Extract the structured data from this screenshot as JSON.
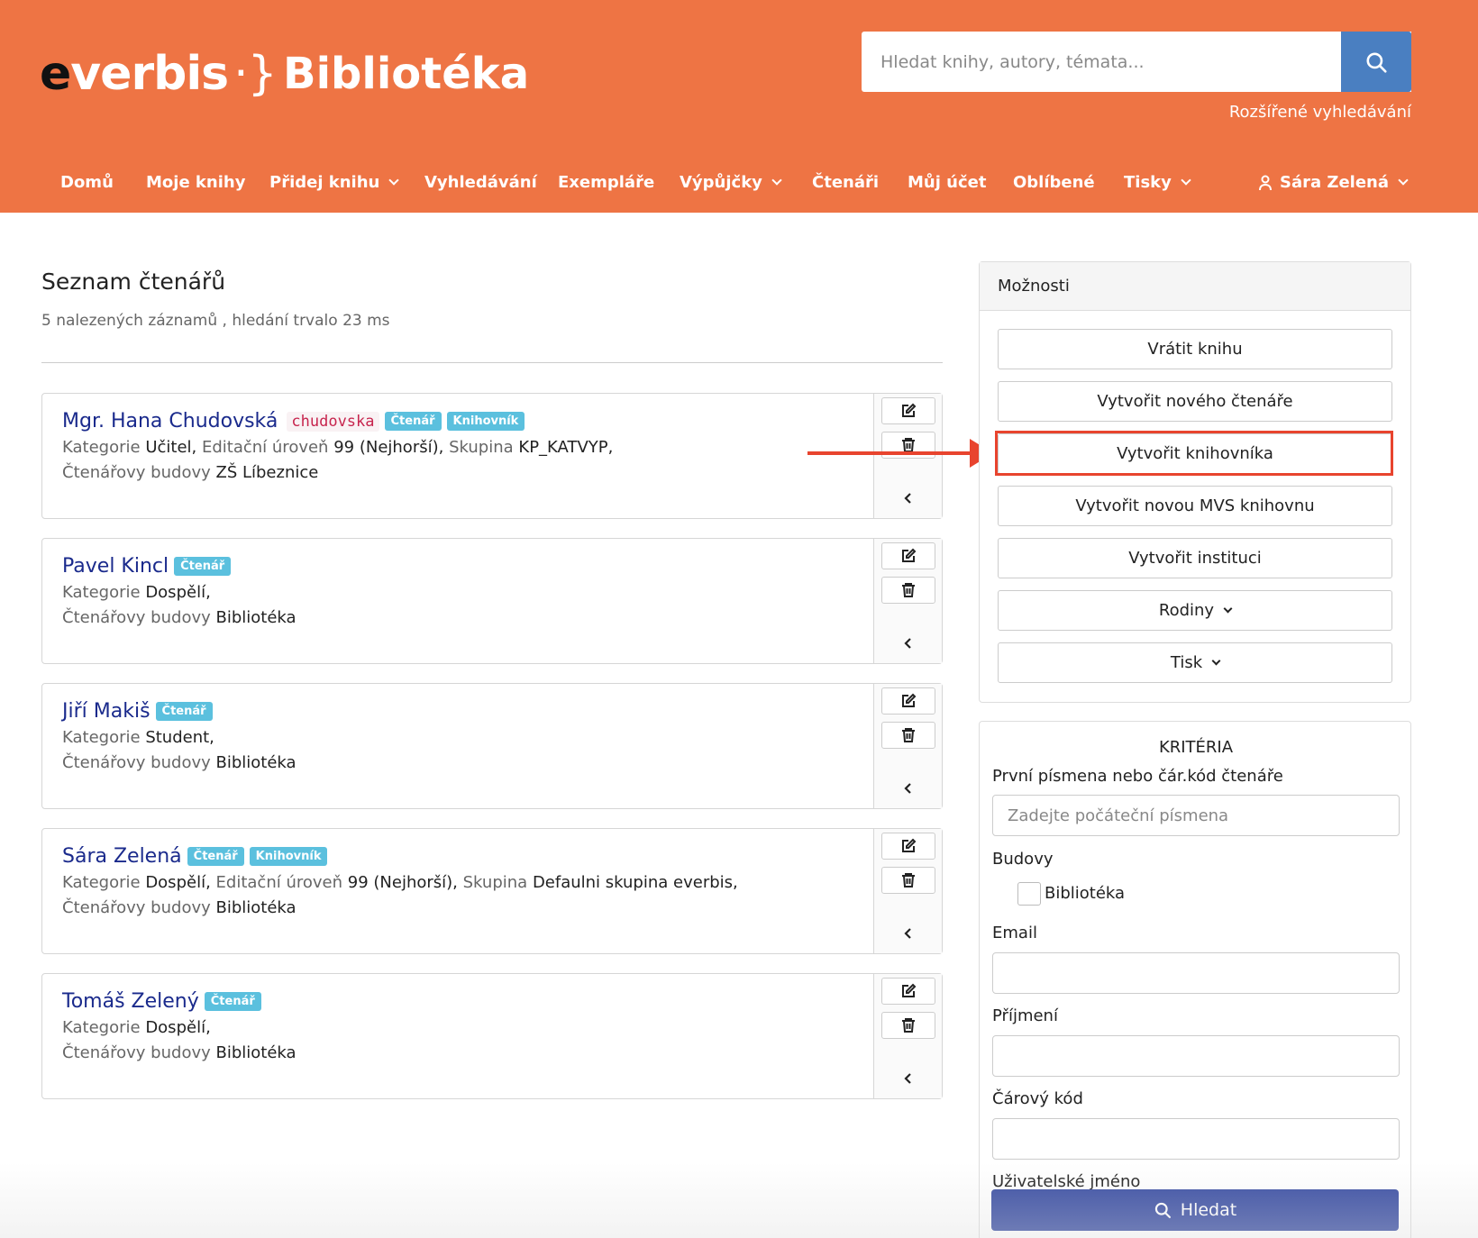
{
  "header": {
    "logo_main": "verbis",
    "logo_e": "e",
    "logo_brace": "·}",
    "site_title": "Bibliotéka",
    "search_placeholder": "Hledat knihy, autory, témata...",
    "advanced_search": "Rozšířené vyhledávání",
    "colors": {
      "header_bg": "#ee7444",
      "search_button": "#4a7fc1"
    }
  },
  "nav": {
    "items": [
      {
        "label": "Domů"
      },
      {
        "label": "Moje knihy"
      },
      {
        "label": "Přidej knihu"
      },
      {
        "label": "Vyhledávání"
      },
      {
        "label": "Exempláře"
      },
      {
        "label": "Výpůjčky"
      },
      {
        "label": "Čtenáři"
      },
      {
        "label": "Můj účet"
      },
      {
        "label": "Oblíbené"
      },
      {
        "label": "Tisky"
      }
    ],
    "user": "Sára Zelená"
  },
  "main": {
    "title": "Seznam čtenářů",
    "result_info": "5 nalezených záznamů , hledání trvalo 23 ms",
    "readers": [
      {
        "name": "Mgr. Hana Chudovská",
        "login": "chudovska",
        "badges": [
          "Čtenář",
          "Knihovník"
        ],
        "line1": [
          {
            "k": "Kategorie",
            "v": "Učitel"
          },
          {
            "k": "Editační úroveň",
            "v": "99 (Nejhorší)"
          },
          {
            "k": "Skupina",
            "v": "KP_KATVYP"
          }
        ],
        "buildings_label": "Čtenářovy budovy",
        "buildings": "ZŠ Líbeznice"
      },
      {
        "name": "Pavel Kincl",
        "badges": [
          "Čtenář"
        ],
        "line1": [
          {
            "k": "Kategorie",
            "v": "Dospělí"
          }
        ],
        "buildings_label": "Čtenářovy budovy",
        "buildings": "Bibliotéka"
      },
      {
        "name": "Jiří Makiš",
        "badges": [
          "Čtenář"
        ],
        "line1": [
          {
            "k": "Kategorie",
            "v": "Student"
          }
        ],
        "buildings_label": "Čtenářovy budovy",
        "buildings": "Bibliotéka"
      },
      {
        "name": "Sára Zelená",
        "badges": [
          "Čtenář",
          "Knihovník"
        ],
        "line1": [
          {
            "k": "Kategorie",
            "v": "Dospělí"
          },
          {
            "k": "Editační úroveň",
            "v": "99 (Nejhorší)"
          },
          {
            "k": "Skupina",
            "v": "Defaulni skupina everbis"
          }
        ],
        "buildings_label": "Čtenářovy budovy",
        "buildings": "Bibliotéka"
      },
      {
        "name": "Tomáš Zelený",
        "badges": [
          "Čtenář"
        ],
        "line1": [
          {
            "k": "Kategorie",
            "v": "Dospělí"
          }
        ],
        "buildings_label": "Čtenářovy budovy",
        "buildings": "Bibliotéka"
      }
    ]
  },
  "options": {
    "title": "Možnosti",
    "buttons": [
      {
        "label": "Vrátit knihu"
      },
      {
        "label": "Vytvořit nového čtenáře"
      },
      {
        "label": "Vytvořit knihovníka"
      },
      {
        "label": "Vytvořit novou MVS knihovnu"
      },
      {
        "label": "Vytvořit instituci"
      },
      {
        "label": "Rodiny"
      },
      {
        "label": "Tisk"
      }
    ]
  },
  "criteria": {
    "title": "KRITÉRIA",
    "first_letters_label": "První písmena nebo čár.kód čtenáře",
    "first_letters_placeholder": "Zadejte počáteční písmena",
    "buildings_label": "Budovy",
    "building_option": "Bibliotéka",
    "email_label": "Email",
    "surname_label": "Příjmení",
    "barcode_label": "Čárový kód",
    "username_label": "Uživatelské jméno",
    "submit_label": "Hledat",
    "colors": {
      "submit_bg": "#3a4ea3",
      "highlight": "#e8442e"
    }
  }
}
